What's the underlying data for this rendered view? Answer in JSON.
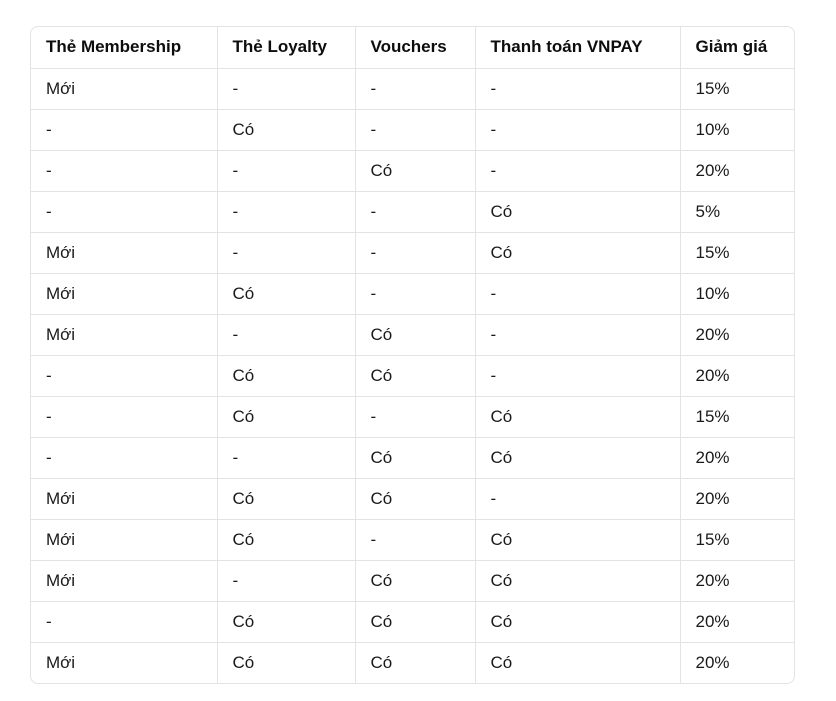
{
  "table": {
    "headers": [
      "Thẻ Membership",
      "Thẻ Loyalty",
      "Vouchers",
      "Thanh toán VNPAY",
      "Giảm giá"
    ],
    "rows": [
      [
        "Mới",
        "-",
        "-",
        "-",
        "15%"
      ],
      [
        "-",
        "Có",
        "-",
        "-",
        "10%"
      ],
      [
        "-",
        "-",
        "Có",
        "-",
        "20%"
      ],
      [
        "-",
        "-",
        "-",
        "Có",
        "5%"
      ],
      [
        "Mới",
        "-",
        "-",
        "Có",
        "15%"
      ],
      [
        "Mới",
        "Có",
        "-",
        "-",
        "10%"
      ],
      [
        "Mới",
        "-",
        "Có",
        "-",
        "20%"
      ],
      [
        "-",
        "Có",
        "Có",
        "-",
        "20%"
      ],
      [
        "-",
        "Có",
        "-",
        "Có",
        "15%"
      ],
      [
        "-",
        "-",
        "Có",
        "Có",
        "20%"
      ],
      [
        "Mới",
        "Có",
        "Có",
        "-",
        "20%"
      ],
      [
        "Mới",
        "Có",
        "-",
        "Có",
        "15%"
      ],
      [
        "Mới",
        "-",
        "Có",
        "Có",
        "20%"
      ],
      [
        "-",
        "Có",
        "Có",
        "Có",
        "20%"
      ],
      [
        "Mới",
        "Có",
        "Có",
        "Có",
        "20%"
      ]
    ]
  },
  "colors": {
    "border": "#e3e3e3",
    "text": "#0d0d0d",
    "background": "#ffffff"
  }
}
